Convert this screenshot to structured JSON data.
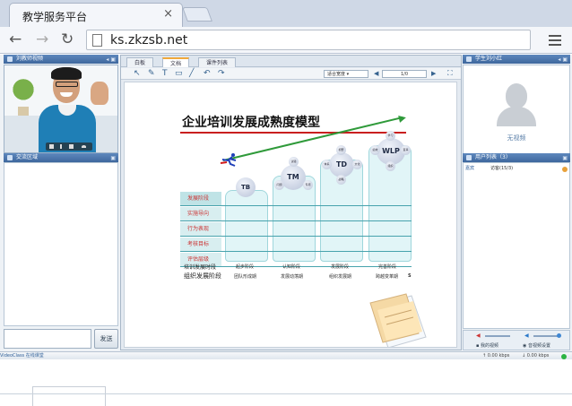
{
  "browser": {
    "tab_title": "教学服务平台",
    "tab_close": "×",
    "url": "ks.zkzsb.net"
  },
  "left": {
    "video_header": "刘教师视频",
    "chat_header": "交流区域",
    "send_label": "发送"
  },
  "center": {
    "tabs": [
      "白板",
      "文档",
      "课件列表"
    ],
    "active_tab": 1,
    "zoom_label": "适合宽度",
    "page_label": "1/0"
  },
  "slide": {
    "title": "企业培训发展成熟度模型",
    "stages": [
      "发展阶段",
      "实施导向",
      "行为表现",
      "考核目标",
      "评估层级"
    ],
    "nodes": [
      "TB",
      "TM",
      "TD",
      "WLP"
    ],
    "row1_label": "培训发展时段",
    "row1_cells": [
      "起步阶段",
      "认知阶段",
      "发展阶段",
      "完善阶段"
    ],
    "row2_label": "组织发展阶段",
    "row2_cells": [
      "团队形成期",
      "发展动荡期",
      "组织发展期",
      "跨越变革期"
    ],
    "tm_bubbles": [
      "试验",
      "问题",
      "专项"
    ],
    "td_bubbles": [
      "视野",
      "体系",
      "文化",
      "战略"
    ],
    "wlp_bubbles": [
      "学习",
      "绩效",
      "变革",
      "组织"
    ],
    "row2_end": "S"
  },
  "right": {
    "video_header": "学生刘小红",
    "no_video": "无视频",
    "user_header": "用户列表（3）",
    "user_row": {
      "name": "嘉宾",
      "info": "访客(15/3)"
    },
    "cam_label": "我的视频",
    "audio_label": "音视频设置"
  },
  "status": {
    "brand": "VideoClass 在线课堂",
    "up": "0.00 kbps",
    "down": "0.00 kbps"
  },
  "colors": {
    "accent": "#3e679d",
    "stage_text": "#c33",
    "title_rule": "#c91f1f",
    "growth_arrow": "#2f9a3a"
  }
}
